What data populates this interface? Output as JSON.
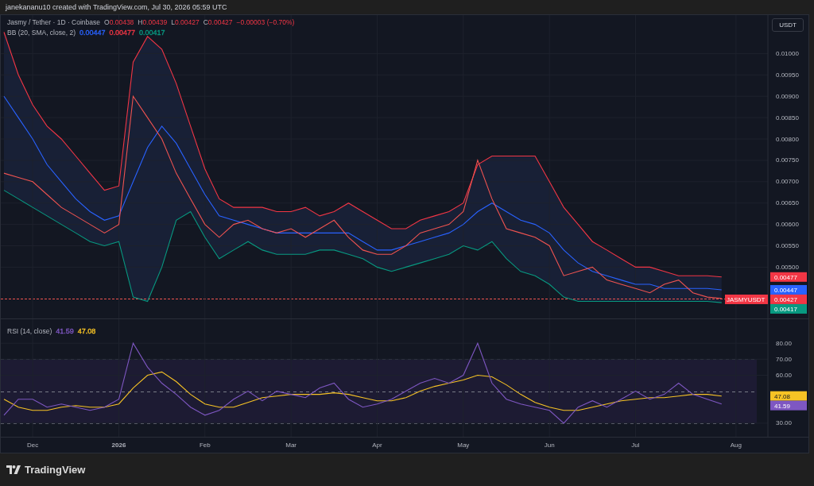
{
  "header": {
    "text": "janekananu10 created with TradingView.com, Jul 30, 2026 05:59 UTC"
  },
  "currency_button": "USDT",
  "legend": {
    "symbol": "Jasmy / Tether · 1D · Coinbase",
    "ohlc": [
      {
        "label": "O",
        "value": "0.00438"
      },
      {
        "label": "H",
        "value": "0.00439"
      },
      {
        "label": "L",
        "value": "0.00427"
      },
      {
        "label": "C",
        "value": "0.00427"
      }
    ],
    "change": "−0.00003 (−0.70%)",
    "indicator": "BB (20, SMA, close, 2)",
    "values": [
      {
        "text": "0.00447",
        "color": "#2962ff"
      },
      {
        "text": "0.00477",
        "color": "#f23645"
      },
      {
        "text": "0.00417",
        "color": "#089981"
      }
    ]
  },
  "price_chart": {
    "chart_data": {
      "type": "line",
      "series": [
        {
          "color": "#f23645",
          "values": [
            0.0105,
            0.0095,
            0.0088,
            0.0083,
            0.008,
            0.0076,
            0.0072,
            0.0068,
            0.0069,
            0.0098,
            0.0104,
            0.0101,
            0.0093,
            0.0083,
            0.0073,
            0.0066,
            0.0064,
            0.0064,
            0.0064,
            0.0063,
            0.0063,
            0.0064,
            0.0062,
            0.0063,
            0.0065,
            0.0063,
            0.0061,
            0.0059,
            0.0059,
            0.0061,
            0.0062,
            0.0063,
            0.0065,
            0.0074,
            0.0076,
            0.0076,
            0.0076,
            0.0076,
            0.007,
            0.0064,
            0.006,
            0.0056,
            0.0054,
            0.0052,
            0.005,
            0.005,
            0.0049,
            0.0048,
            0.0048,
            0.0048,
            0.00477
          ]
        },
        {
          "color": "#2962ff",
          "values": [
            0.009,
            0.0085,
            0.008,
            0.0074,
            0.007,
            0.0066,
            0.0063,
            0.0061,
            0.0062,
            0.007,
            0.0078,
            0.0083,
            0.0079,
            0.0073,
            0.0067,
            0.0062,
            0.0061,
            0.006,
            0.0059,
            0.0058,
            0.0058,
            0.0058,
            0.0058,
            0.0058,
            0.0058,
            0.0056,
            0.0054,
            0.0054,
            0.0055,
            0.0056,
            0.0057,
            0.0058,
            0.006,
            0.0063,
            0.0065,
            0.0063,
            0.0061,
            0.006,
            0.0058,
            0.0054,
            0.0051,
            0.0049,
            0.0048,
            0.0047,
            0.0046,
            0.0046,
            0.0045,
            0.0045,
            0.0045,
            0.0045,
            0.00447
          ]
        },
        {
          "color": "#ef5350",
          "values": [
            0.0072,
            0.0071,
            0.007,
            0.0067,
            0.0064,
            0.0062,
            0.006,
            0.0058,
            0.006,
            0.009,
            0.0085,
            0.008,
            0.0072,
            0.0066,
            0.006,
            0.0057,
            0.006,
            0.0061,
            0.0059,
            0.0058,
            0.0059,
            0.0057,
            0.0059,
            0.0061,
            0.0057,
            0.0054,
            0.0053,
            0.0053,
            0.0055,
            0.0058,
            0.0059,
            0.006,
            0.0063,
            0.0075,
            0.0066,
            0.0059,
            0.0058,
            0.0057,
            0.0055,
            0.0048,
            0.0049,
            0.005,
            0.0047,
            0.0046,
            0.0045,
            0.0044,
            0.0046,
            0.0047,
            0.0044,
            0.0043,
            0.00427
          ]
        },
        {
          "color": "#089981",
          "values": [
            0.0068,
            0.0066,
            0.0064,
            0.0062,
            0.006,
            0.0058,
            0.0056,
            0.0055,
            0.0056,
            0.0043,
            0.0042,
            0.005,
            0.0061,
            0.0063,
            0.0057,
            0.0052,
            0.0054,
            0.0056,
            0.0054,
            0.0053,
            0.0053,
            0.0053,
            0.0054,
            0.0054,
            0.0053,
            0.0052,
            0.005,
            0.0049,
            0.005,
            0.0051,
            0.0052,
            0.0053,
            0.0055,
            0.0054,
            0.0056,
            0.0052,
            0.0049,
            0.0048,
            0.0046,
            0.0043,
            0.0042,
            0.0042,
            0.0042,
            0.0042,
            0.0042,
            0.0042,
            0.0042,
            0.0042,
            0.0042,
            0.0042,
            0.00417
          ]
        }
      ],
      "ylim": [
        0.0038,
        0.0109
      ],
      "yticks": [
        {
          "value": 0.005,
          "label": "0.00500"
        },
        {
          "value": 0.0055,
          "label": "0.00550"
        },
        {
          "value": 0.006,
          "label": "0.00600"
        },
        {
          "value": 0.0065,
          "label": "0.00650"
        },
        {
          "value": 0.007,
          "label": "0.00700"
        },
        {
          "value": 0.0075,
          "label": "0.00750"
        },
        {
          "value": 0.008,
          "label": "0.00800"
        },
        {
          "value": 0.0085,
          "label": "0.00850"
        },
        {
          "value": 0.009,
          "label": "0.00900"
        },
        {
          "value": 0.0095,
          "label": "0.00950"
        },
        {
          "value": 0.01,
          "label": "0.01000"
        }
      ],
      "grid": true
    }
  },
  "price_scale_labels": [
    {
      "text": "0.00477",
      "color": "#f23645"
    },
    {
      "text": "0.00447",
      "color": "#2962ff"
    },
    {
      "text": "0.00427",
      "color": "#f23645",
      "tag": "JASMYUSDT"
    },
    {
      "text": "0.00417",
      "color": "#089981"
    }
  ],
  "rsi_legend": {
    "indicator": "RSI (14, close)",
    "values": [
      {
        "text": "41.59",
        "color": "#7e57c2"
      },
      {
        "text": "47.08",
        "color": "#f7c325"
      }
    ]
  },
  "rsi_chart": {
    "chart_data": {
      "type": "line",
      "categories": [
        null,
        null,
        "Dec",
        null,
        null,
        null,
        null,
        null,
        "2026",
        null,
        null,
        null,
        null,
        null,
        "Feb",
        null,
        null,
        null,
        null,
        null,
        "Mar",
        null,
        null,
        null,
        null,
        null,
        "Apr",
        null,
        null,
        null,
        null,
        null,
        "May",
        null,
        null,
        null,
        null,
        null,
        "Jun",
        null,
        null,
        null,
        null,
        null,
        "Jul",
        null,
        null,
        null,
        null,
        null,
        null,
        "Aug",
        null,
        null
      ],
      "series": [
        {
          "color": "#f7c325",
          "values": [
            45,
            40,
            38,
            38,
            40,
            41,
            40,
            40,
            42,
            52,
            60,
            62,
            56,
            48,
            42,
            40,
            40,
            43,
            46,
            47,
            48,
            48,
            48,
            49,
            48,
            46,
            44,
            44,
            46,
            50,
            53,
            55,
            57,
            60,
            59,
            54,
            48,
            43,
            40,
            38,
            38,
            40,
            42,
            44,
            45,
            46,
            46,
            47,
            48,
            48,
            47,
            null,
            null,
            null
          ]
        },
        {
          "color": "#7e57c2",
          "values": [
            35,
            45,
            45,
            40,
            42,
            40,
            38,
            40,
            45,
            80,
            65,
            55,
            48,
            40,
            35,
            38,
            45,
            50,
            44,
            50,
            48,
            46,
            52,
            55,
            45,
            40,
            42,
            45,
            50,
            55,
            58,
            55,
            60,
            80,
            55,
            45,
            42,
            40,
            38,
            30,
            40,
            44,
            40,
            45,
            50,
            45,
            48,
            55,
            48,
            45,
            42,
            null,
            null,
            null
          ]
        }
      ],
      "ylim": [
        21.5,
        95
      ],
      "yticks": [
        {
          "value": 30,
          "label": "30.00"
        },
        {
          "value": 60,
          "label": "60.00"
        },
        {
          "value": 70,
          "label": "70.00"
        },
        {
          "value": 80,
          "label": "80.00"
        }
      ],
      "grid": true
    }
  },
  "rsi_scale_labels": [
    {
      "text": "47.08",
      "color": "#f7c325"
    },
    {
      "text": "41.59",
      "color": "#7e57c2"
    }
  ],
  "footer": {
    "brand": "TradingView"
  }
}
